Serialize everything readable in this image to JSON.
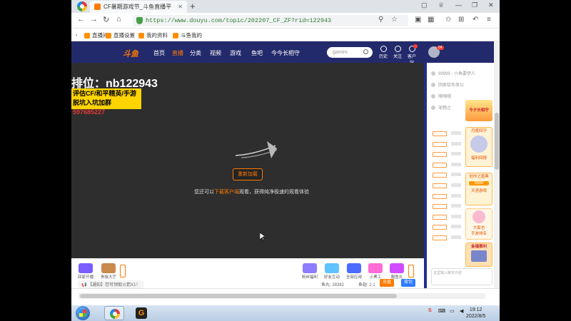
{
  "browser": {
    "tab_title": "CF暑期游戏节_斗鱼直播平",
    "url": "https://www.douyu.com/topic/202207_CF_ZF?rid=122943",
    "new_tab": "+",
    "bookmarks": [
      "直播间",
      "直播设置",
      "我的资料",
      "斗鱼我的"
    ]
  },
  "site": {
    "logo": "斗鱼",
    "nav": [
      "首页",
      "直播",
      "分类",
      "视频",
      "游戏",
      "鱼吧",
      "今今长相守"
    ],
    "search_placeholder": "gamini",
    "header_icons": [
      "历史",
      "关注",
      "客户端"
    ],
    "avatar_badge": "04"
  },
  "video": {
    "ad_title": "排位：nb122943",
    "ad_line1": "评估CF/和平精英/手游",
    "ad_line2_prefix": "脱坑入坑加群",
    "ad_line2_number": "597685227",
    "reload_button": "重新加载",
    "hint_prefix": "您还可以",
    "hint_link": "下载客户端",
    "hint_suffix": "观看，获得纯净极速的观看体验"
  },
  "giftbar": {
    "left_gifts": [
      "回家开播",
      "贵族大厅"
    ],
    "right_gifts": [
      "粉丝福利",
      "好友互动",
      "全部应用",
      "小黑工",
      "赠鱼丸"
    ],
    "notice": "【通知】您可领取火箭X1！",
    "stat_fish": "鱼丸: 28382",
    "stat_level": "鱼翅: 2.1",
    "btn_charge": "充值",
    "btn_pack": "背包"
  },
  "sidepanel": {
    "top_rows": [
      "99999 - 小鱼要伊人",
      "回家给你发公",
      "嗨嗨哦",
      "宠物之"
    ],
    "promo_texts": [
      "今夕长相守",
      "月度回守",
      "福利回报",
      "创作之盛典",
      "5000",
      "天涯游戏",
      "大家也",
      "手游排名",
      "金福报利"
    ],
    "chat_placeholder": "这里输入聊天内容"
  },
  "taskbar": {
    "time": "19:12",
    "date": "2022/8/5"
  },
  "colors": {
    "douyu_header": "#232a6b",
    "accent": "#ff7a00",
    "video_bg": "#2e2e2e",
    "ad_yellow": "#ffd400"
  }
}
